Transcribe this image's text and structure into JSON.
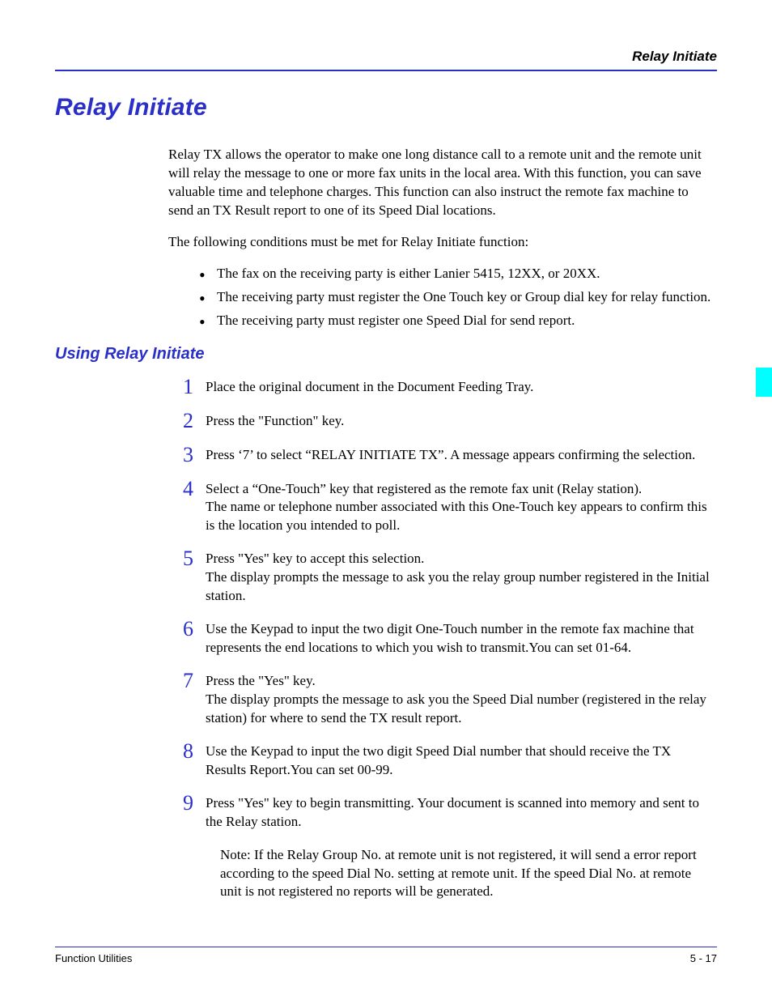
{
  "running_head": "Relay Initiate",
  "h1": "Relay Initiate",
  "intro_p1": "Relay TX allows the operator to make one long distance call to a remote unit and the remote unit will relay the message to one or more fax units in the local area. With this function, you can save valuable time and telephone charges. This function can also instruct the remote fax machine to send an TX Result report to one of its Speed Dial locations.",
  "intro_p2": "The following conditions must be met for Relay Initiate function:",
  "bullets": [
    "The fax on the receiving party is either Lanier 5415, 12XX, or 20XX.",
    "The receiving party must register the One Touch key or Group dial key for relay function.",
    "The receiving party must register one Speed Dial for send report."
  ],
  "h2": "Using Relay Initiate",
  "steps": [
    {
      "n": "1",
      "t": "Place the original document in the Document Feeding Tray."
    },
    {
      "n": "2",
      "t": "Press the \"Function\" key."
    },
    {
      "n": "3",
      "t": "Press ‘7’ to select “RELAY INITIATE TX”. A message appears confirming the selection."
    },
    {
      "n": "4",
      "t": "Select a “One-Touch” key that registered as the remote fax unit (Relay station).\nThe name or telephone number associated with this One-Touch key appears to confirm this is the location you intended to poll."
    },
    {
      "n": "5",
      "t": "Press \"Yes\" key to accept this selection.\nThe display prompts the message to ask you the relay group number registered in the Initial station."
    },
    {
      "n": "6",
      "t": "Use the Keypad to input the two digit One-Touch number in the remote fax machine that represents the end locations to which you wish to transmit.You can set 01-64."
    },
    {
      "n": "7",
      "t": "Press the \"Yes\" key.\nThe display prompts the message to ask you the Speed Dial number (registered in the relay station) for where to send the TX result report."
    },
    {
      "n": "8",
      "t": "Use the Keypad to input the two digit Speed Dial number that should receive the TX Results Report.You can set 00-99."
    },
    {
      "n": "9",
      "t": "Press \"Yes\" key to begin transmitting. Your document is scanned into memory and sent to the Relay station."
    }
  ],
  "note": "Note:  If the Relay Group No. at remote unit is not registered, it will send a error report according to the speed Dial No. setting at remote unit. If the speed Dial No. at remote unit is not registered no reports will be generated.",
  "footer_left": "Function Utilities",
  "footer_right": "5 - 17"
}
